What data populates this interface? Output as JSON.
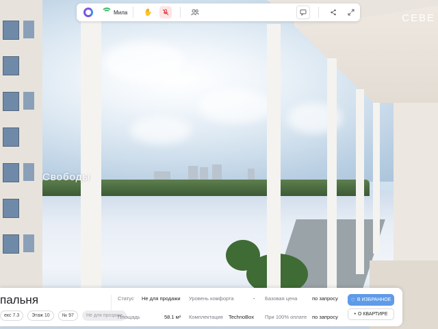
{
  "brand": "СЕВЕ",
  "city_label": "Свободы",
  "toolbar": {
    "user_name": "Мила"
  },
  "room": {
    "title": "пальня",
    "chips": [
      "екс 7.3",
      "Этаж 10",
      "№ 97",
      "Не для продажи"
    ]
  },
  "info": {
    "status_label": "Статус",
    "status_value": "Не для продажи",
    "area_label": "Площадь",
    "area_value": "58.1 м²",
    "comfort_label": "Уровень комфорта",
    "comfort_value": "-",
    "kit_label": "Комплектация",
    "kit_value": "TechnoBox",
    "base_price_label": "Базовая цена",
    "base_price_value": "по запросу",
    "full_pay_label": "При 100% оплате",
    "full_pay_value": "по запросу"
  },
  "buttons": {
    "favorite": "В ИЗБРАННОЕ",
    "about": "О КВАРТИРЕ"
  },
  "colors": {
    "accent": "#5e9be8",
    "logo": "#7a52e0",
    "online": "#3bb86a",
    "mic_off": "#d94848"
  }
}
